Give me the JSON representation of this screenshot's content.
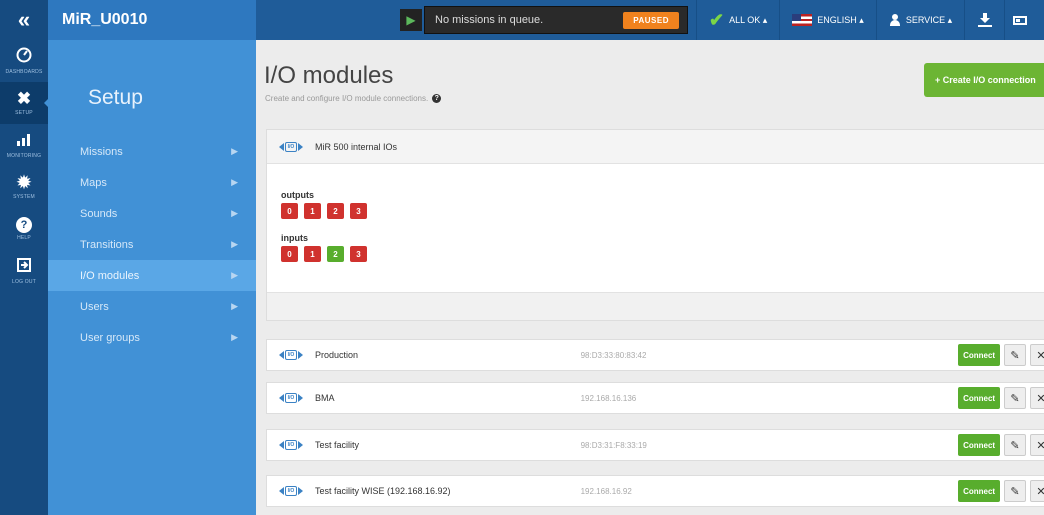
{
  "topbar": {
    "collapse_icon": "double-chevron-left-icon",
    "robot_name": "MiR_U0010",
    "mission_text": "No missions in queue.",
    "state_badge": "PAUSED",
    "status_label": "ALL OK ▴",
    "language_label": "ENGLISH ▴",
    "user_label": "SERVICE ▴"
  },
  "leftnav": [
    {
      "icon": "dashboard-icon",
      "label": "DASHBOARDS"
    },
    {
      "icon": "setup-tools-icon",
      "label": "SETUP"
    },
    {
      "icon": "monitoring-icon",
      "label": "MONITORING"
    },
    {
      "icon": "system-gear-icon",
      "label": "SYSTEM"
    },
    {
      "icon": "help-icon",
      "label": "HELP"
    },
    {
      "icon": "logout-icon",
      "label": "LOG OUT"
    }
  ],
  "setup": {
    "title": "Setup",
    "items": [
      "Missions",
      "Maps",
      "Sounds",
      "Transitions",
      "I/O modules",
      "Users",
      "User groups"
    ],
    "active_index": 4
  },
  "page": {
    "title": "I/O modules",
    "subtitle": "Create and configure I/O module connections.",
    "create_button": "+ Create I/O connection"
  },
  "internal_module": {
    "name": "MiR 500 internal IOs",
    "outputs_label": "outputs",
    "outputs": [
      {
        "label": "0",
        "state": "off"
      },
      {
        "label": "1",
        "state": "off"
      },
      {
        "label": "2",
        "state": "off"
      },
      {
        "label": "3",
        "state": "off"
      }
    ],
    "inputs_label": "inputs",
    "inputs": [
      {
        "label": "0",
        "state": "off"
      },
      {
        "label": "1",
        "state": "off"
      },
      {
        "label": "2",
        "state": "on"
      },
      {
        "label": "3",
        "state": "off"
      }
    ]
  },
  "connect_label": "Connect",
  "modules": [
    {
      "name": "Production",
      "address": "98:D3:33:80:83:42"
    },
    {
      "name": "BMA",
      "address": "192.168.16.136"
    },
    {
      "name": "Test facility",
      "address": "98:D3:31:F8:33:19"
    },
    {
      "name": "Test facility WISE (192.168.16.92)",
      "address": "192.168.16.92"
    }
  ],
  "colors": {
    "topbar": "#1f5c99",
    "setup_menu": "#4191d6",
    "port_on": "#58ad2d",
    "port_off": "#d0322e",
    "accent_green": "#6cb534",
    "paused_orange": "#f0821e"
  }
}
